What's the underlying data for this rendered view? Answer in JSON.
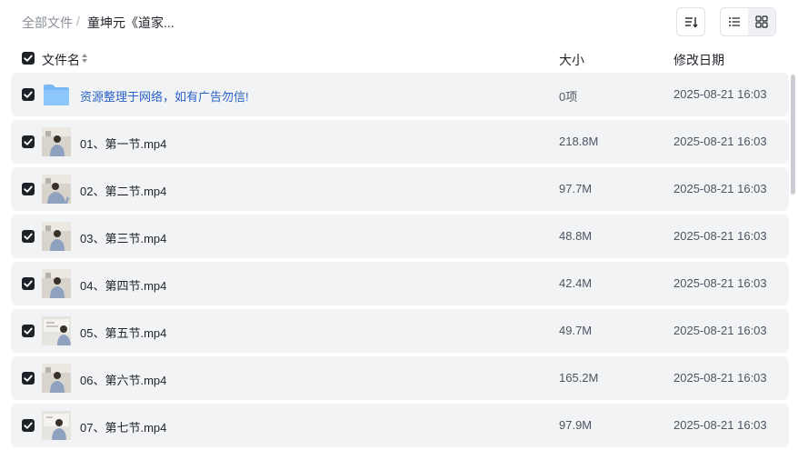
{
  "breadcrumb": {
    "root": "全部文件",
    "separator": "/",
    "current": "童坤元《道家..."
  },
  "toolbar": {
    "sort_icon": "sort-icon",
    "list_view_icon": "list-view-icon",
    "grid_view_icon": "grid-view-icon",
    "active_view": "list"
  },
  "header": {
    "name": "文件名",
    "size": "大小",
    "date": "修改日期"
  },
  "files": [
    {
      "type": "folder",
      "name": "资源整理于网络，如有广告勿信!",
      "size": "0项",
      "date": "2025-08-21 16:03",
      "checked": true
    },
    {
      "type": "video",
      "name": "01、第一节.mp4",
      "size": "218.8M",
      "date": "2025-08-21 16:03",
      "checked": true
    },
    {
      "type": "video",
      "name": "02、第二节.mp4",
      "size": "97.7M",
      "date": "2025-08-21 16:03",
      "checked": true
    },
    {
      "type": "video",
      "name": "03、第三节.mp4",
      "size": "48.8M",
      "date": "2025-08-21 16:03",
      "checked": true
    },
    {
      "type": "video",
      "name": "04、第四节.mp4",
      "size": "42.4M",
      "date": "2025-08-21 16:03",
      "checked": true
    },
    {
      "type": "video",
      "name": "05、第五节.mp4",
      "size": "49.7M",
      "date": "2025-08-21 16:03",
      "checked": true
    },
    {
      "type": "video",
      "name": "06、第六节.mp4",
      "size": "165.2M",
      "date": "2025-08-21 16:03",
      "checked": true
    },
    {
      "type": "video",
      "name": "07、第七节.mp4",
      "size": "97.9M",
      "date": "2025-08-21 16:03",
      "checked": true
    }
  ],
  "colors": {
    "row_bg": "#f2f3f5",
    "folder_text": "#2a62c9",
    "folder_icon": "#7ab8f5"
  }
}
